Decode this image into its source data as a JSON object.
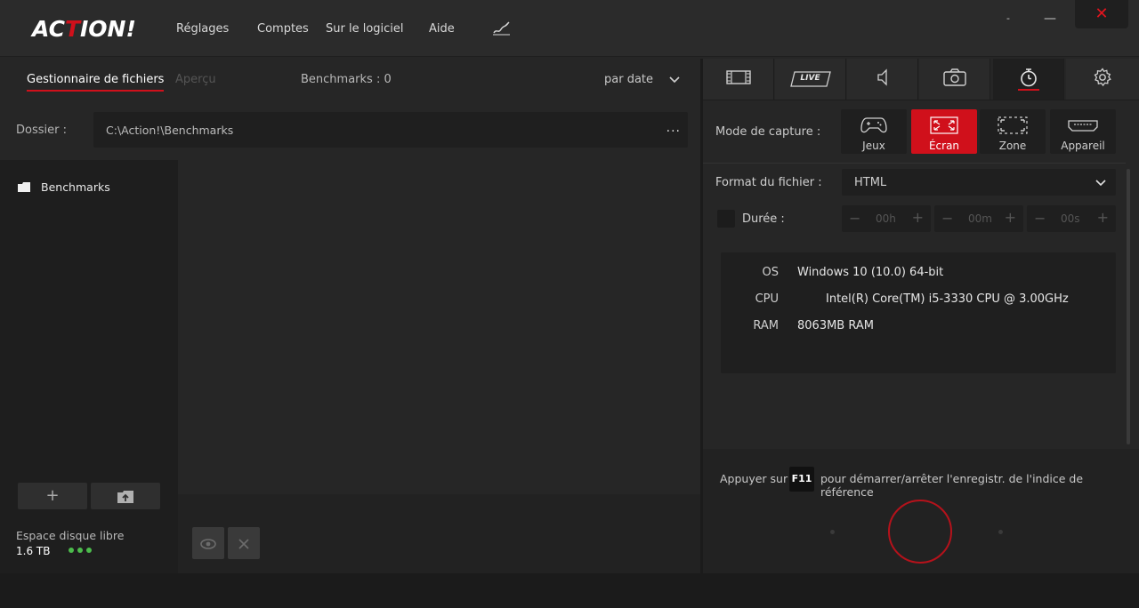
{
  "app": {
    "logo_prefix": "AC",
    "logo_mid": "T",
    "logo_suffix": "ION!"
  },
  "menu": {
    "items": [
      "Réglages",
      "Comptes",
      "Sur le logiciel",
      "Aide"
    ]
  },
  "window": {
    "minimize": "-",
    "maximize": "—",
    "close": "✕"
  },
  "left": {
    "tabs": {
      "files": "Gestionnaire de fichiers",
      "preview": "Aperçu"
    },
    "bench_count": "Benchmarks : 0",
    "sort": "par date",
    "folder_label": "Dossier :",
    "folder_path": "C:\\Action!\\Benchmarks",
    "folder_more": "...",
    "tree": [
      {
        "label": "Benchmarks",
        "icon": "folder-icon"
      }
    ],
    "add_button": "+",
    "disk_label": "Espace disque libre",
    "disk_value": "1.6 TB"
  },
  "right": {
    "tabs": [
      "video-icon",
      "live-icon",
      "audio-icon",
      "camera-icon",
      "benchmark-icon",
      "gear-icon"
    ],
    "live_text": "LIVE",
    "capture_label": "Mode de capture :",
    "modes": [
      {
        "label": "Jeux",
        "icon": "gamepad-icon"
      },
      {
        "label": "Écran",
        "icon": "fullscreen-icon",
        "active": true
      },
      {
        "label": "Zone",
        "icon": "area-icon"
      },
      {
        "label": "Appareil",
        "icon": "hdmi-icon"
      }
    ],
    "format_label": "Format du fichier :",
    "format_value": "HTML",
    "duration_label": "Durée :",
    "duration": {
      "hours": "00h",
      "minutes": "00m",
      "seconds": "00s"
    },
    "sysinfo": [
      {
        "key": "OS",
        "value": "Windows 10 (10.0) 64-bit"
      },
      {
        "key": "CPU",
        "value": "Intel(R) Core(TM) i5-3330 CPU @ 3.00GHz"
      },
      {
        "key": "RAM",
        "value": "8063MB RAM"
      }
    ],
    "hint_pre": "Appuyer sur",
    "hint_key": "F11",
    "hint_post": "pour démarrer/arrêter l'enregistr. de l'indice de référence"
  },
  "colors": {
    "accent": "#d0101b",
    "status_ok": "#4cbb4c"
  }
}
